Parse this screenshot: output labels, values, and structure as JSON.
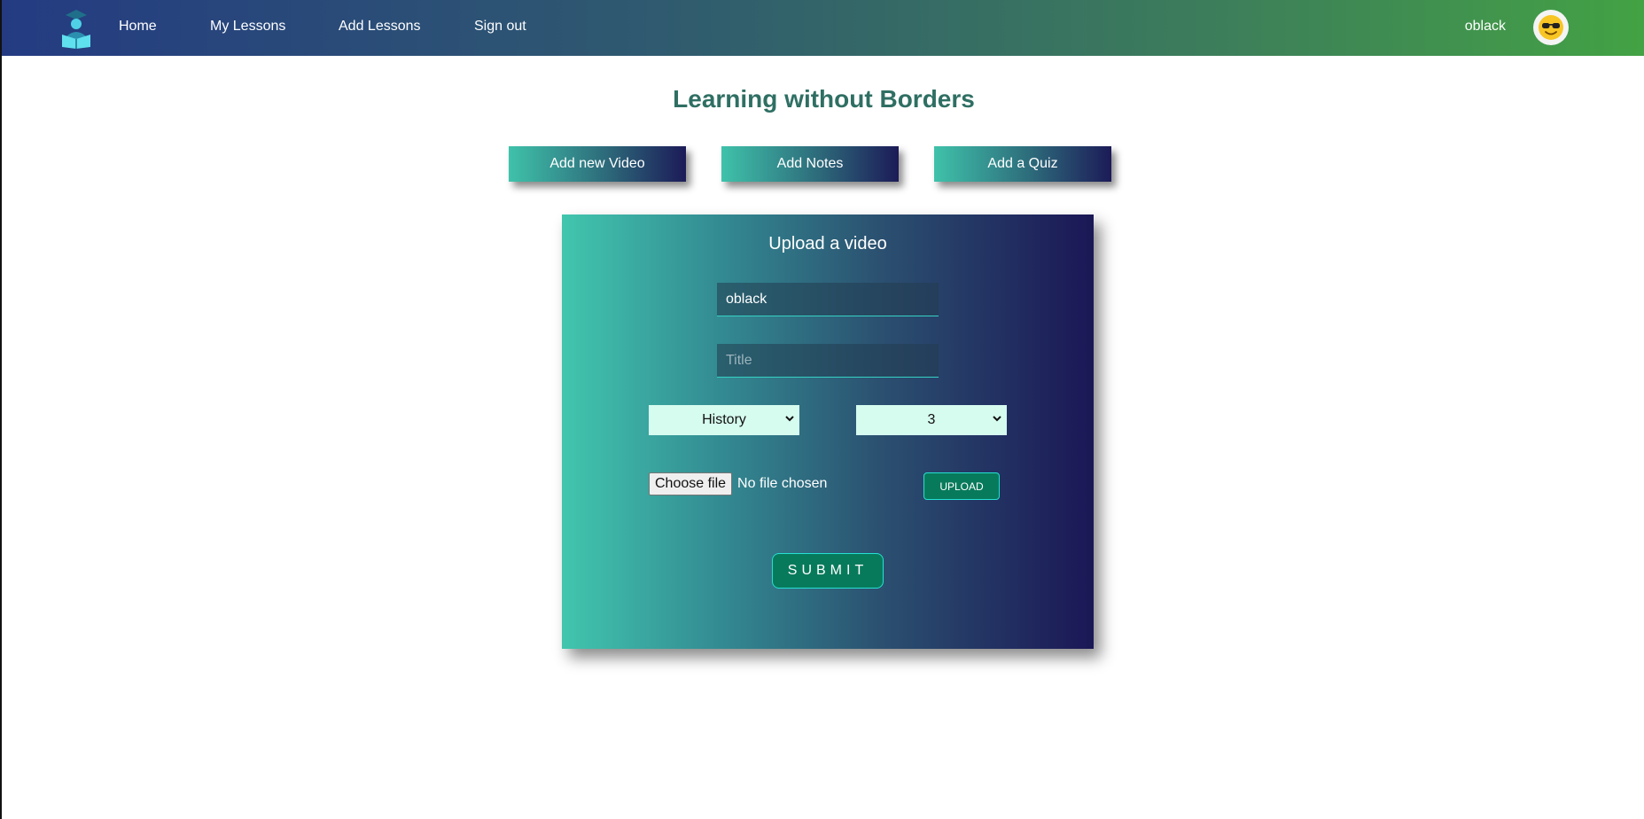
{
  "nav": {
    "logo_icon": "graduate-reading-icon",
    "links": [
      "Home",
      "My Lessons",
      "Add Lessons",
      "Sign out"
    ],
    "username": "oblack",
    "avatar_icon": "sunglasses-emoji-icon"
  },
  "page_title": "Learning without Borders",
  "tabs": [
    "Add new Video",
    "Add Notes",
    "Add a Quiz"
  ],
  "form": {
    "title": "Upload a video",
    "author_value": "oblack",
    "title_placeholder": "Title",
    "subject_selected": "History",
    "grade_selected": "3",
    "choose_file_label": "Choose file",
    "file_status": "No file chosen",
    "upload_label": "UPLOAD",
    "submit_label": "SUBMIT"
  },
  "colors": {
    "accent": "#087a5c",
    "title_color": "#2f6f63",
    "select_bg": "#d6fbef"
  }
}
